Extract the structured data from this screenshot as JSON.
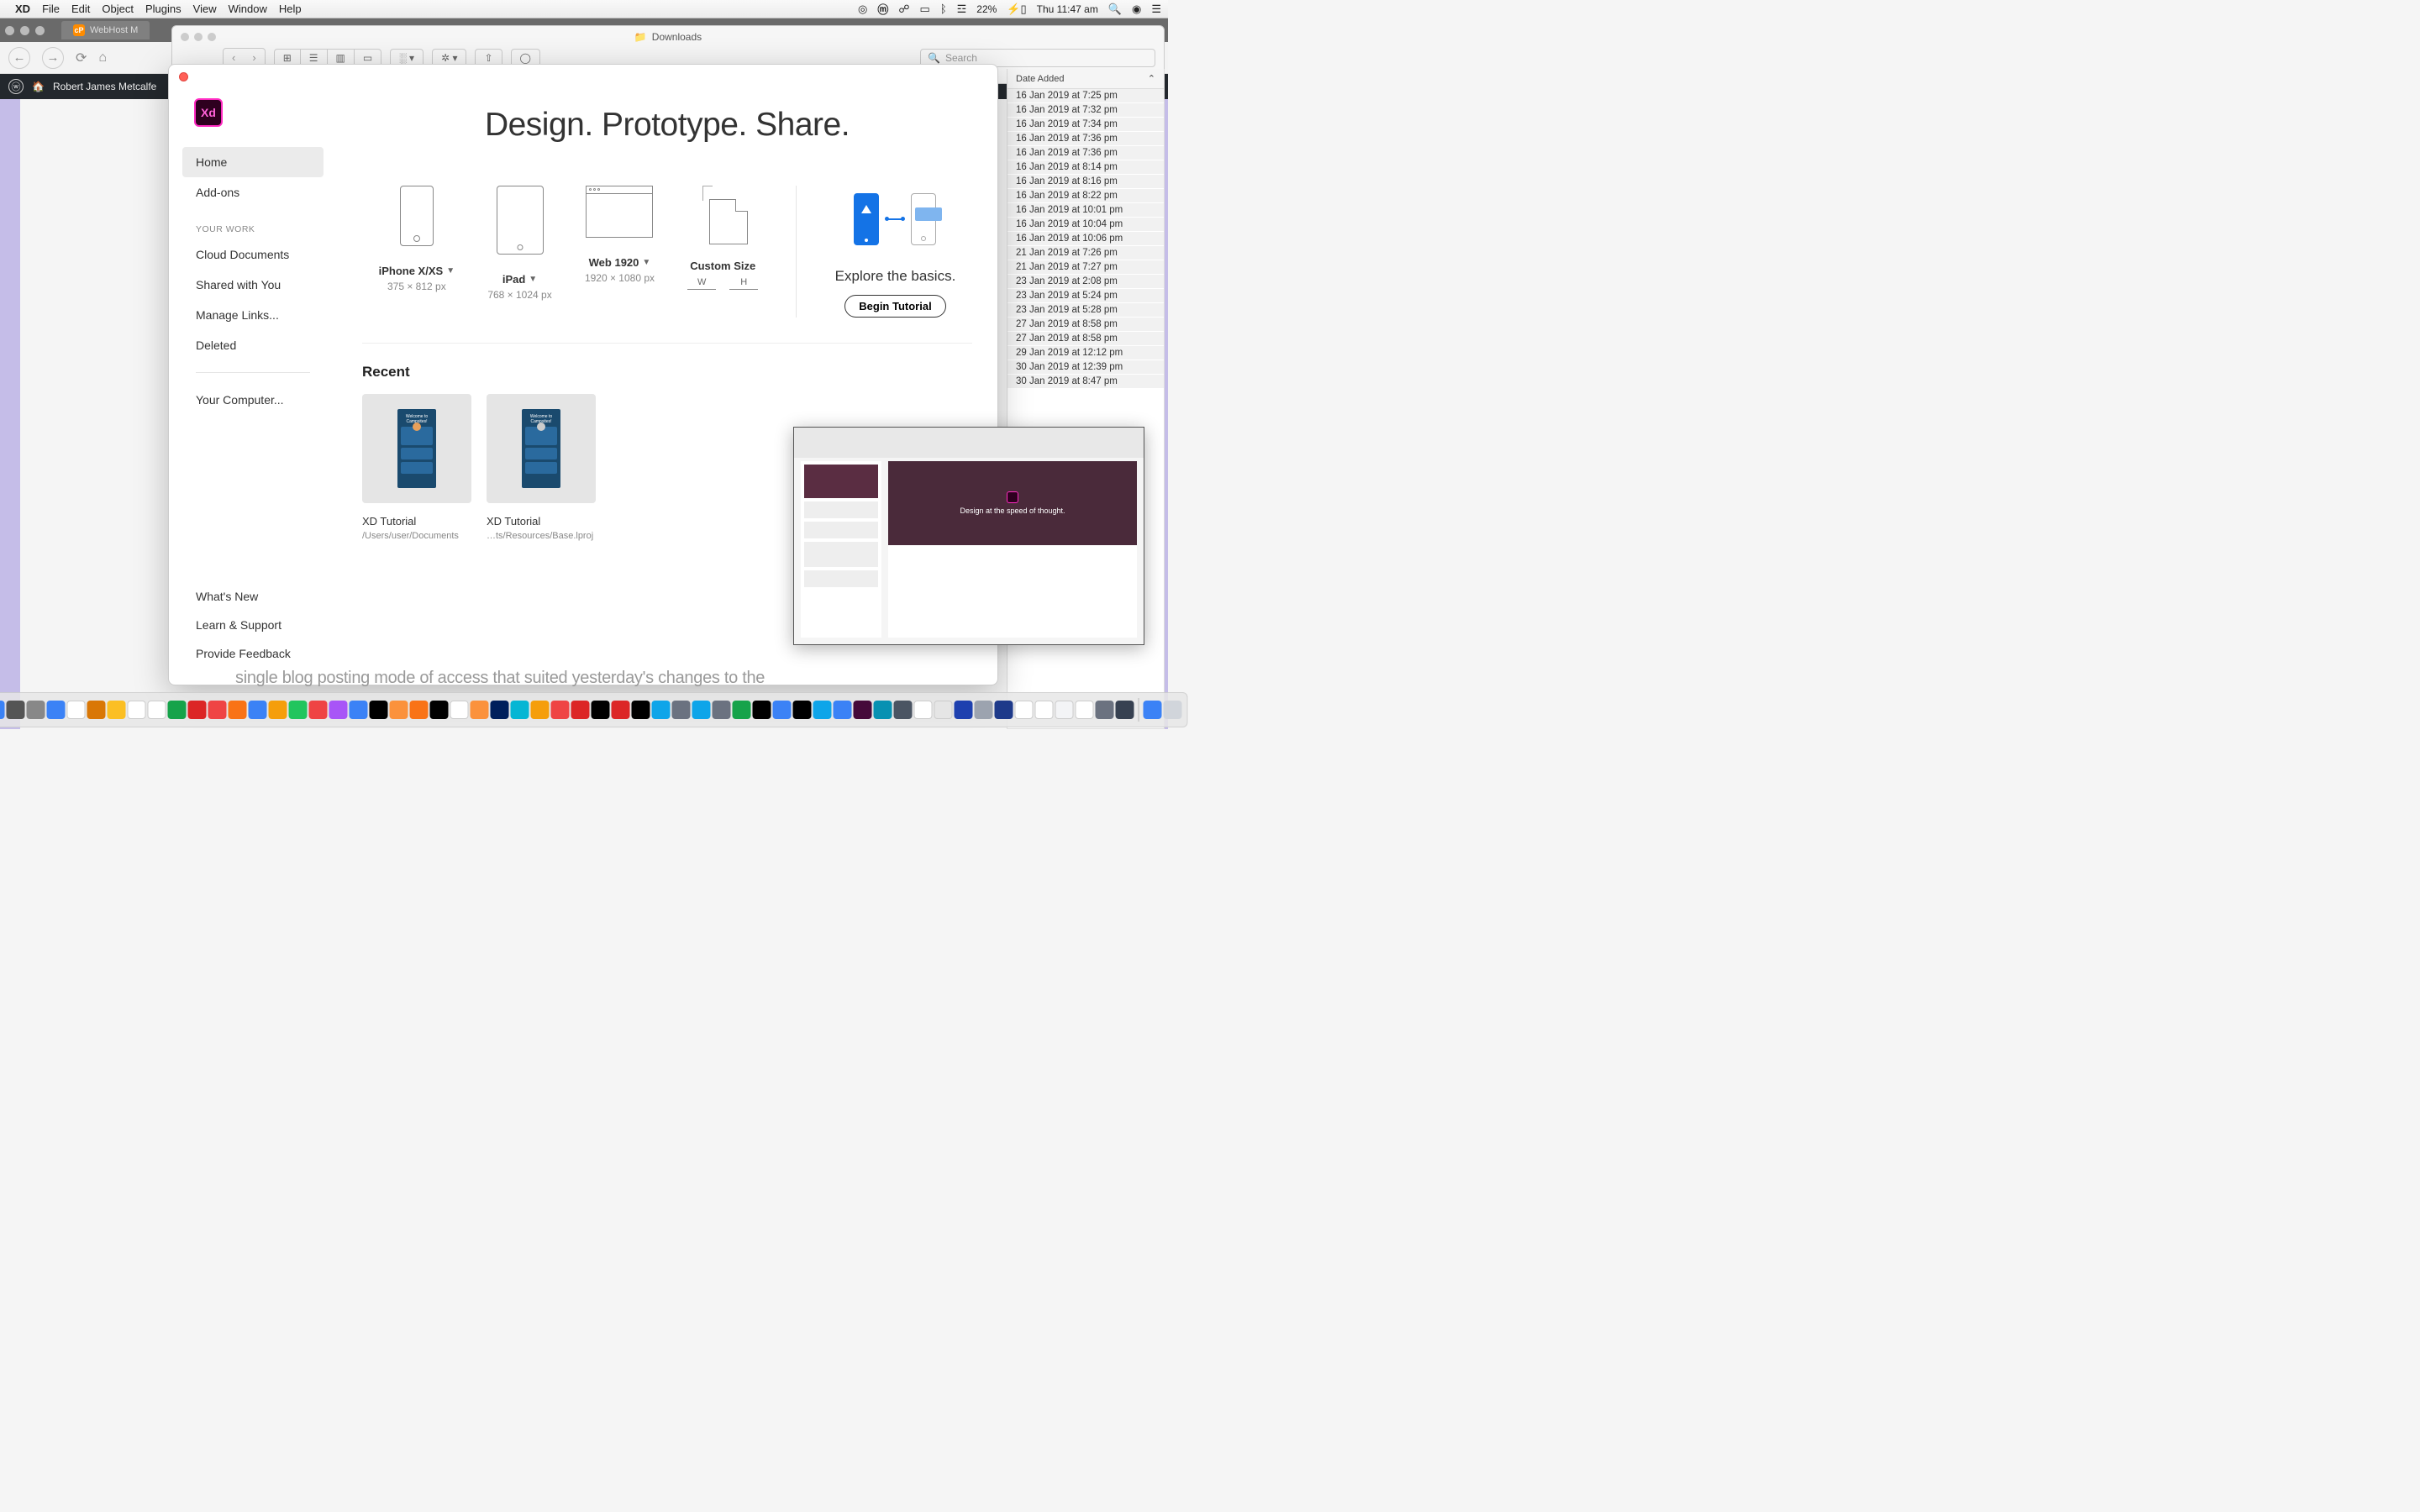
{
  "menubar": {
    "app": "XD",
    "items": [
      "File",
      "Edit",
      "Object",
      "Plugins",
      "View",
      "Window",
      "Help"
    ],
    "battery": "22%",
    "clock": "Thu 11:47 am"
  },
  "browser": {
    "tab_label": "WebHost M",
    "wp_site": "Robert James Metcalfe"
  },
  "finder": {
    "title": "Downloads",
    "search_placeholder": "Search",
    "date_header": "Date Added",
    "dates": [
      "16 Jan 2019 at 7:25 pm",
      "16 Jan 2019 at 7:32 pm",
      "16 Jan 2019 at 7:34 pm",
      "16 Jan 2019 at 7:36 pm",
      "16 Jan 2019 at 7:36 pm",
      "16 Jan 2019 at 8:14 pm",
      "16 Jan 2019 at 8:16 pm",
      "16 Jan 2019 at 8:22 pm",
      "16 Jan 2019 at 10:01 pm",
      "16 Jan 2019 at 10:04 pm",
      "16 Jan 2019 at 10:06 pm",
      "21 Jan 2019 at 7:26 pm",
      "21 Jan 2019 at 7:27 pm",
      "23 Jan 2019 at 2:08 pm",
      "23 Jan 2019 at 5:24 pm",
      "23 Jan 2019 at 5:28 pm",
      "27 Jan 2019 at 8:58 pm",
      "27 Jan 2019 at 8:58 pm",
      "29 Jan 2019 at 12:12 pm",
      "30 Jan 2019 at 12:39 pm",
      "30 Jan 2019 at 8:47 pm"
    ]
  },
  "xd": {
    "hero": "Design. Prototype. Share.",
    "sidebar": {
      "home": "Home",
      "addons": "Add-ons",
      "your_work": "YOUR WORK",
      "cloud": "Cloud Documents",
      "shared": "Shared with You",
      "manage": "Manage Links...",
      "deleted": "Deleted",
      "computer": "Your Computer...",
      "whatsnew": "What's New",
      "learn": "Learn & Support",
      "feedback": "Provide Feedback"
    },
    "artboards": {
      "iphone": {
        "label": "iPhone X/XS",
        "dims": "375 × 812 px"
      },
      "ipad": {
        "label": "iPad",
        "dims": "768 × 1024 px"
      },
      "web": {
        "label": "Web 1920",
        "dims": "1920 × 1080 px"
      },
      "custom": {
        "label": "Custom Size",
        "w": "W",
        "h": "H"
      }
    },
    "tutorial": {
      "title": "Explore the basics.",
      "button": "Begin Tutorial"
    },
    "recent": {
      "header": "Recent",
      "items": [
        {
          "name": "XD Tutorial",
          "path": "/Users/user/Documents"
        },
        {
          "name": "XD Tutorial",
          "path": "…ts/Resources/Base.lproj"
        }
      ]
    }
  },
  "pip": {
    "hero_text": "Design at the speed of thought."
  },
  "ghost": "single blog posting mode of access that suited yesterday's changes to the",
  "dock_colors": [
    "#3b82f6",
    "#555",
    "#888",
    "#3b82f6",
    "#fff",
    "#d97706",
    "#fbbf24",
    "#fff",
    "#fff",
    "#16a34a",
    "#dc2626",
    "#ef4444",
    "#f97316",
    "#3b82f6",
    "#f59e0b",
    "#22c55e",
    "#ef4444",
    "#a855f7",
    "#3b82f6",
    "#000",
    "#fb923c",
    "#f97316",
    "#000",
    "#fff",
    "#fb923c",
    "#001f5c",
    "#06b6d4",
    "#f59e0b",
    "#ef4444",
    "#dc2626",
    "#000",
    "#dc2626",
    "#000",
    "#0ea5e9",
    "#6b7280",
    "#0ea5e9",
    "#6b7280",
    "#16a34a",
    "#000",
    "#3b82f6",
    "#000",
    "#0ea5e9",
    "#3b82f6",
    "#450a3a",
    "#0891b2",
    "#4b5563",
    "#fff",
    "#e5e5e5",
    "#1e40af",
    "#9ca3af",
    "#1e3a8a",
    "#fff",
    "#fff",
    "#f3f4f6",
    "#fff",
    "#6b7280",
    "#374151"
  ]
}
